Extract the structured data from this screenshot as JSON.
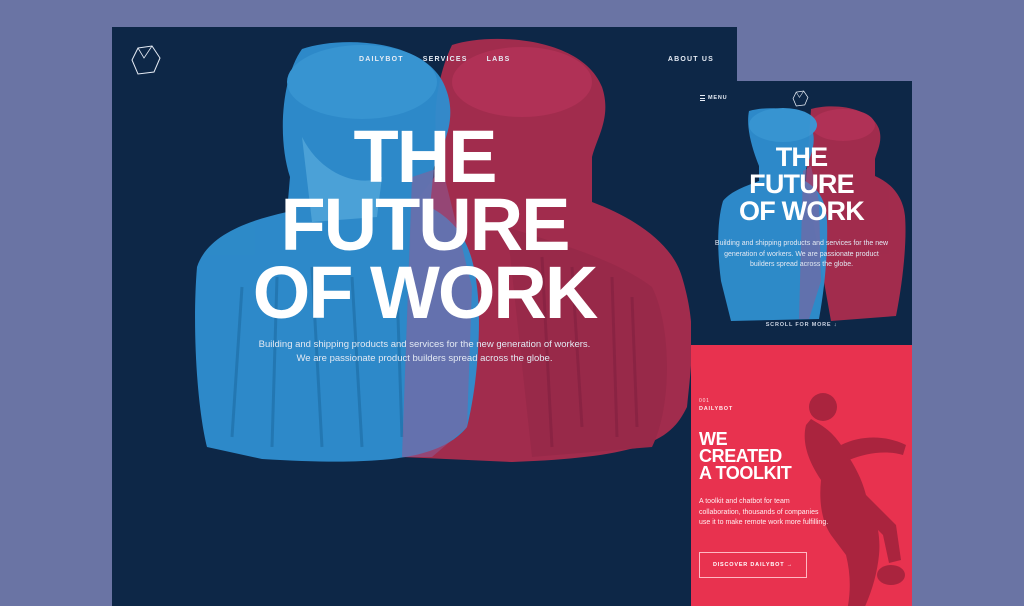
{
  "desktop": {
    "nav": {
      "logo_icon": "polyhedron-icon",
      "links": [
        "DAILYBOT",
        "SERVICES",
        "LABS"
      ],
      "about": "ABOUT US"
    },
    "hero": {
      "title_lines": [
        "THE",
        "FUTURE",
        "OF WORK"
      ],
      "copy_lines": [
        "Building and shipping products and services for the new generation of workers.",
        "We are passionate product builders spread across the globe."
      ]
    }
  },
  "mobile": {
    "menu_label": "MENU",
    "logo_icon": "polyhedron-icon",
    "hero": {
      "title_lines": [
        "THE",
        "FUTURE",
        "OF WORK"
      ],
      "copy_lines": [
        "Building and shipping products and services for the new",
        "generation of workers. We are passionate product",
        "builders spread across the globe."
      ],
      "scroll": "SCROLL FOR MORE ↓"
    },
    "section": {
      "number": "001",
      "kicker": "DAILYBOT",
      "heading_lines": [
        "WE",
        "CREATED",
        "A TOOLKIT"
      ],
      "description": "A toolkit and chatbot for team collaboration, thousands of companies use it to make remote work more fulfilling.",
      "button": "DISCOVER DAILYBOT →"
    }
  },
  "colors": {
    "page_bg": "#6a74a4",
    "navy": "#0d2747",
    "blue": "#2f8fd0",
    "red": "#e8324f"
  }
}
